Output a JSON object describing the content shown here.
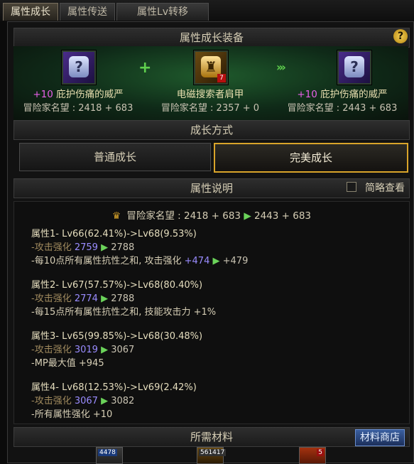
{
  "tabs": [
    "属性成长",
    "属性传送",
    "属性Lv转移"
  ],
  "equip_section": {
    "title": "属性成长装备",
    "items": [
      {
        "enhance": "+10",
        "name": "庇护伤痛的威严",
        "fame": "冒险家名望 : 2418 + 683",
        "icon": "scroll-icon"
      },
      {
        "enhance": "",
        "name": "电磁搜索者肩甲",
        "fame": "冒险家名望 : 2357 + 0",
        "icon": "shoulder-armor-icon",
        "badge": "7"
      },
      {
        "enhance": "+10",
        "name": "庇护伤痛的威严",
        "fame": "冒险家名望 : 2443 + 683",
        "icon": "scroll-icon"
      }
    ]
  },
  "growth_section": {
    "title": "成长方式",
    "options": [
      "普通成长",
      "完美成长"
    ],
    "selected": "完美成长"
  },
  "desc_section": {
    "title": "属性说明",
    "simple_view": "简略查看",
    "fame_label": "冒险家名望 : 2418 + 683",
    "fame_after": "2443 + 683",
    "attrs": [
      {
        "title": "属性1- Lv66(62.41%)->Lv68(9.53%)",
        "sub_label": "-攻击强化",
        "sub_from": "2759",
        "sub_to": "2788",
        "effect": "-每10点所有属性抗性之和, 攻击强化",
        "effect_from": "+474",
        "effect_to": "+479"
      },
      {
        "title": "属性2- Lv67(57.57%)->Lv68(80.40%)",
        "sub_label": "-攻击强化",
        "sub_from": "2774",
        "sub_to": "2788",
        "effect": "-每15点所有属性抗性之和, 技能攻击力 +1%"
      },
      {
        "title": "属性3- Lv65(99.85%)->Lv68(30.48%)",
        "sub_label": "-攻击强化",
        "sub_from": "3019",
        "sub_to": "3067",
        "effect": "-MP最大值 +945"
      },
      {
        "title": "属性4- Lv68(12.53%)->Lv69(2.42%)",
        "sub_label": "-攻击强化",
        "sub_from": "3067",
        "sub_to": "3082",
        "effect": "-所有属性强化 +10"
      }
    ]
  },
  "materials_section": {
    "title": "所需材料",
    "shop_button": "材料商店",
    "items": [
      {
        "count": "4478"
      },
      {
        "count": "561417"
      },
      {
        "count": "5"
      }
    ]
  }
}
